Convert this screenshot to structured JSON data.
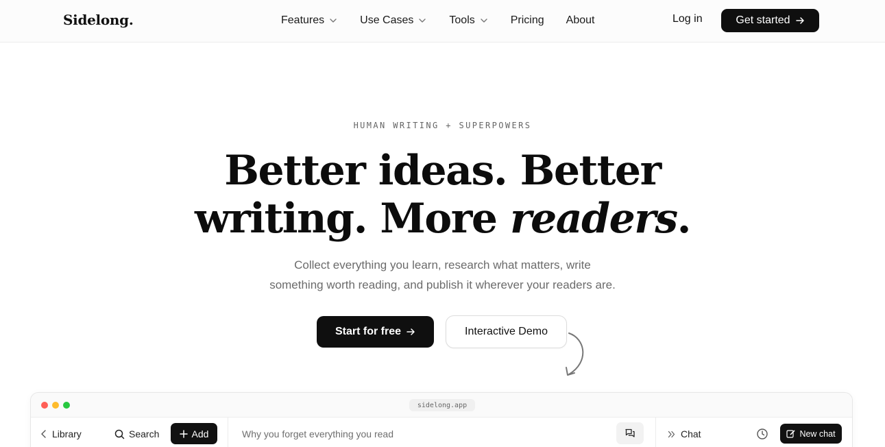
{
  "brand": {
    "logo": "Sidelong."
  },
  "nav": {
    "items": [
      {
        "label": "Features",
        "has_dropdown": true
      },
      {
        "label": "Use Cases",
        "has_dropdown": true
      },
      {
        "label": "Tools",
        "has_dropdown": true
      },
      {
        "label": "Pricing",
        "has_dropdown": false
      },
      {
        "label": "About",
        "has_dropdown": false
      }
    ],
    "login": "Log in",
    "cta": "Get started"
  },
  "hero": {
    "eyebrow": "HUMAN WRITING + SUPERPOWERS",
    "headline_line1": "Better ideas. Better",
    "headline_line2_plain": "writing. More ",
    "headline_line2_em": "readers",
    "headline_line2_end": ".",
    "subtitle_line1": "Collect everything you learn, research what matters, write",
    "subtitle_line2": "something worth reading, and publish it wherever your readers are.",
    "primary_cta": "Start for free",
    "secondary_cta": "Interactive Demo"
  },
  "app_preview": {
    "url": "sidelong.app",
    "left": {
      "library": "Library",
      "search": "Search",
      "add": "Add"
    },
    "middle": {
      "doc_title": "Why you forget everything you read"
    },
    "right": {
      "chat": "Chat",
      "new_chat": "New chat"
    }
  },
  "colors": {
    "accent": "#0f0f0f",
    "text_muted": "#6b6b6b",
    "traffic_red": "#ff5f57",
    "traffic_yellow": "#febc2e",
    "traffic_green": "#28c840"
  }
}
